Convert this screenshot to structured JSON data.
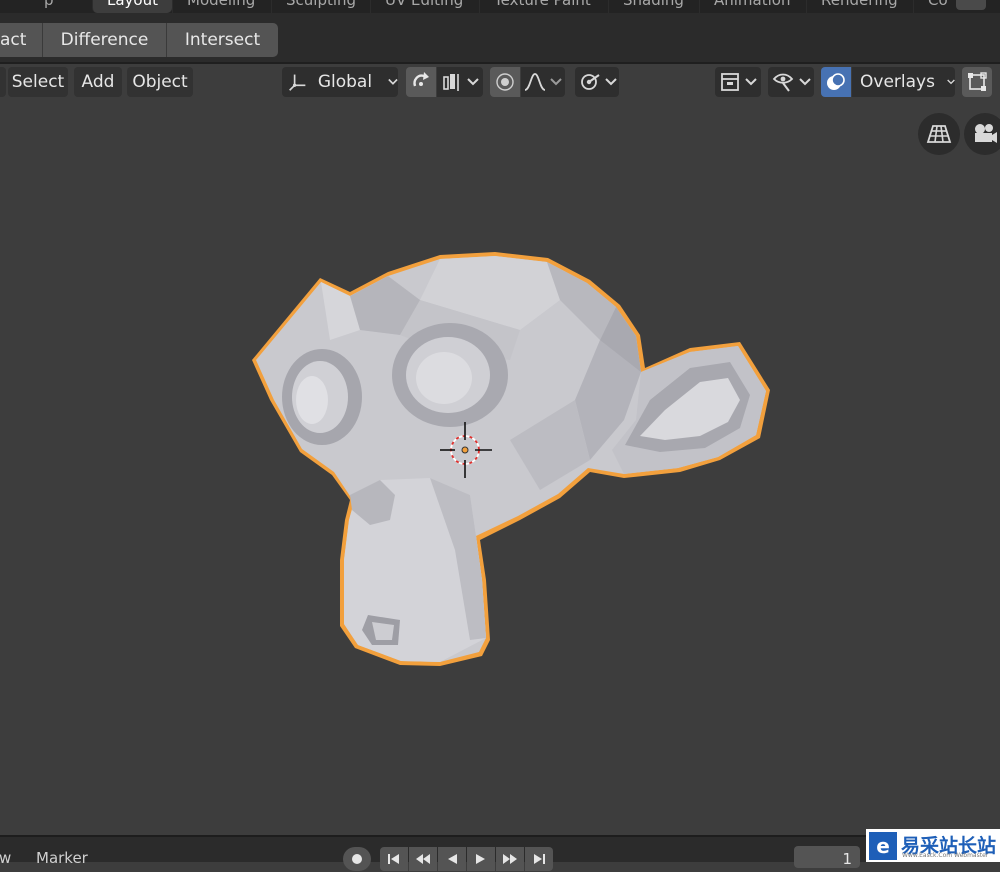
{
  "workspace_tabs": [
    "Layout",
    "Modeling",
    "Sculpting",
    "UV Editing",
    "Texture Paint",
    "Shading",
    "Animation",
    "Rendering",
    "Co"
  ],
  "workspace_partial_left": "p",
  "boolean_panel": {
    "buttons": [
      "act",
      "Difference",
      "Intersect"
    ]
  },
  "viewport_header": {
    "menu": [
      "Select",
      "Add",
      "Object"
    ],
    "transform_orientation": "Global",
    "overlays_label": "Overlays"
  },
  "timeline": {
    "view_partial": "w",
    "marker_label": "Marker",
    "current_frame": "1"
  },
  "watermark": {
    "logo_char": "e",
    "text": "易采站长站",
    "sub": "Www.Easck.Com Webmaster"
  },
  "colors": {
    "viewport_bg": "#3d3d3d",
    "selection_outline": "#f2a03d",
    "overlay_accent": "#4772b3"
  }
}
